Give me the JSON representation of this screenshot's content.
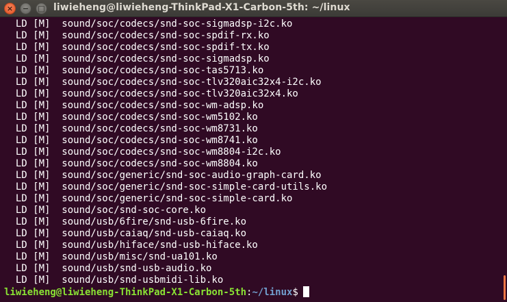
{
  "window": {
    "title": "liwieheng@liwieheng-ThinkPad-X1-Carbon-5th: ~/linux",
    "buttons": {
      "close_glyph": "×",
      "minimize_glyph": "−",
      "maximize_glyph": "□"
    }
  },
  "terminal": {
    "colors": {
      "background": "#300a24",
      "text": "#ffffff",
      "prompt_user": "#8ae234",
      "prompt_path": "#729fcf",
      "scrollbar_thumb": "#f07746"
    },
    "lines": [
      "  LD [M]  sound/soc/codecs/snd-soc-sigmadsp-i2c.ko",
      "  LD [M]  sound/soc/codecs/snd-soc-spdif-rx.ko",
      "  LD [M]  sound/soc/codecs/snd-soc-spdif-tx.ko",
      "  LD [M]  sound/soc/codecs/snd-soc-sigmadsp.ko",
      "  LD [M]  sound/soc/codecs/snd-soc-tas5713.ko",
      "  LD [M]  sound/soc/codecs/snd-soc-tlv320aic32x4-i2c.ko",
      "  LD [M]  sound/soc/codecs/snd-soc-tlv320aic32x4.ko",
      "  LD [M]  sound/soc/codecs/snd-soc-wm-adsp.ko",
      "  LD [M]  sound/soc/codecs/snd-soc-wm5102.ko",
      "  LD [M]  sound/soc/codecs/snd-soc-wm8731.ko",
      "  LD [M]  sound/soc/codecs/snd-soc-wm8741.ko",
      "  LD [M]  sound/soc/codecs/snd-soc-wm8804-i2c.ko",
      "  LD [M]  sound/soc/codecs/snd-soc-wm8804.ko",
      "  LD [M]  sound/soc/generic/snd-soc-audio-graph-card.ko",
      "  LD [M]  sound/soc/generic/snd-soc-simple-card-utils.ko",
      "  LD [M]  sound/soc/generic/snd-soc-simple-card.ko",
      "  LD [M]  sound/soc/snd-soc-core.ko",
      "  LD [M]  sound/usb/6fire/snd-usb-6fire.ko",
      "  LD [M]  sound/usb/caiaq/snd-usb-caiaq.ko",
      "  LD [M]  sound/usb/hiface/snd-usb-hiface.ko",
      "  LD [M]  sound/usb/misc/snd-ua101.ko",
      "  LD [M]  sound/usb/snd-usb-audio.ko",
      "  LD [M]  sound/usb/snd-usbmidi-lib.ko"
    ],
    "prompt": {
      "user_host": "liwieheng@liwieheng-ThinkPad-X1-Carbon-5th",
      "separator": ":",
      "path": "~/linux",
      "symbol": "$"
    }
  }
}
